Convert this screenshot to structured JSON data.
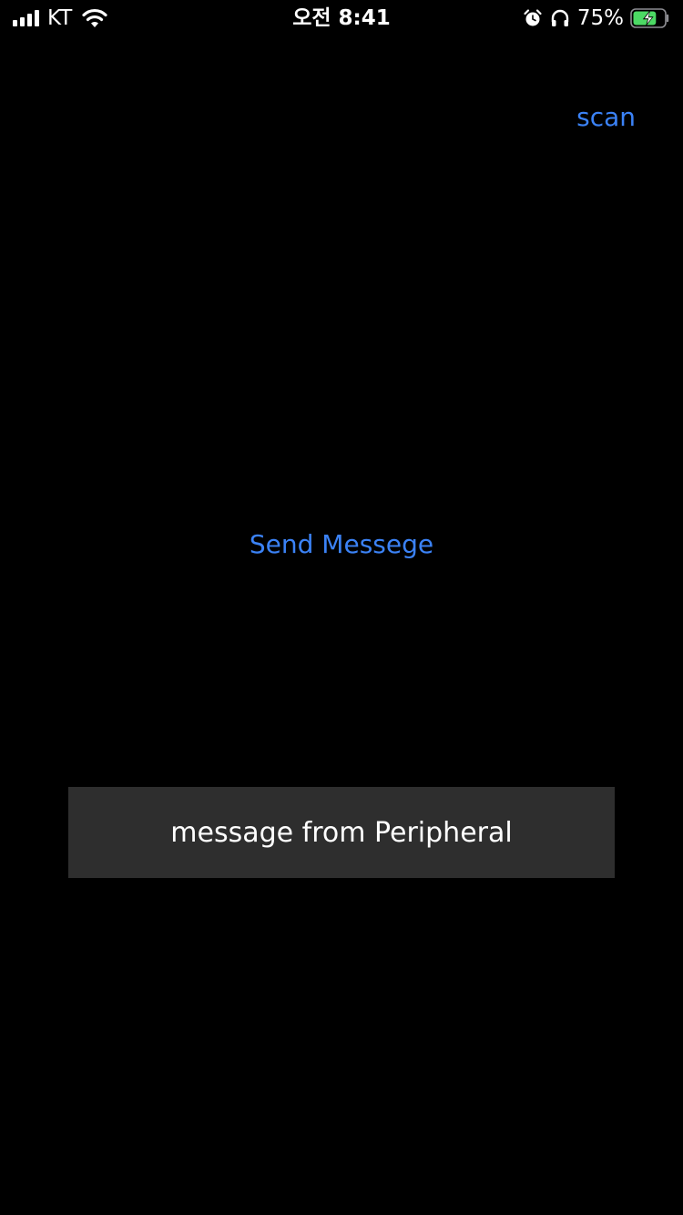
{
  "status_bar": {
    "carrier": "KT",
    "time": "오전 8:41",
    "battery_percent": "75%",
    "battery_level": 0.75,
    "icons": [
      "signal-icon",
      "wifi-icon",
      "alarm-icon",
      "headphones-icon",
      "battery-charging-icon"
    ]
  },
  "nav": {
    "scan_label": "scan"
  },
  "main": {
    "send_label": "Send Messege",
    "message_text": "message from Peripheral"
  },
  "colors": {
    "background": "#000000",
    "accent": "#3b82f6",
    "message_box": "#2e2e2e",
    "battery_fill": "#4cd964"
  }
}
